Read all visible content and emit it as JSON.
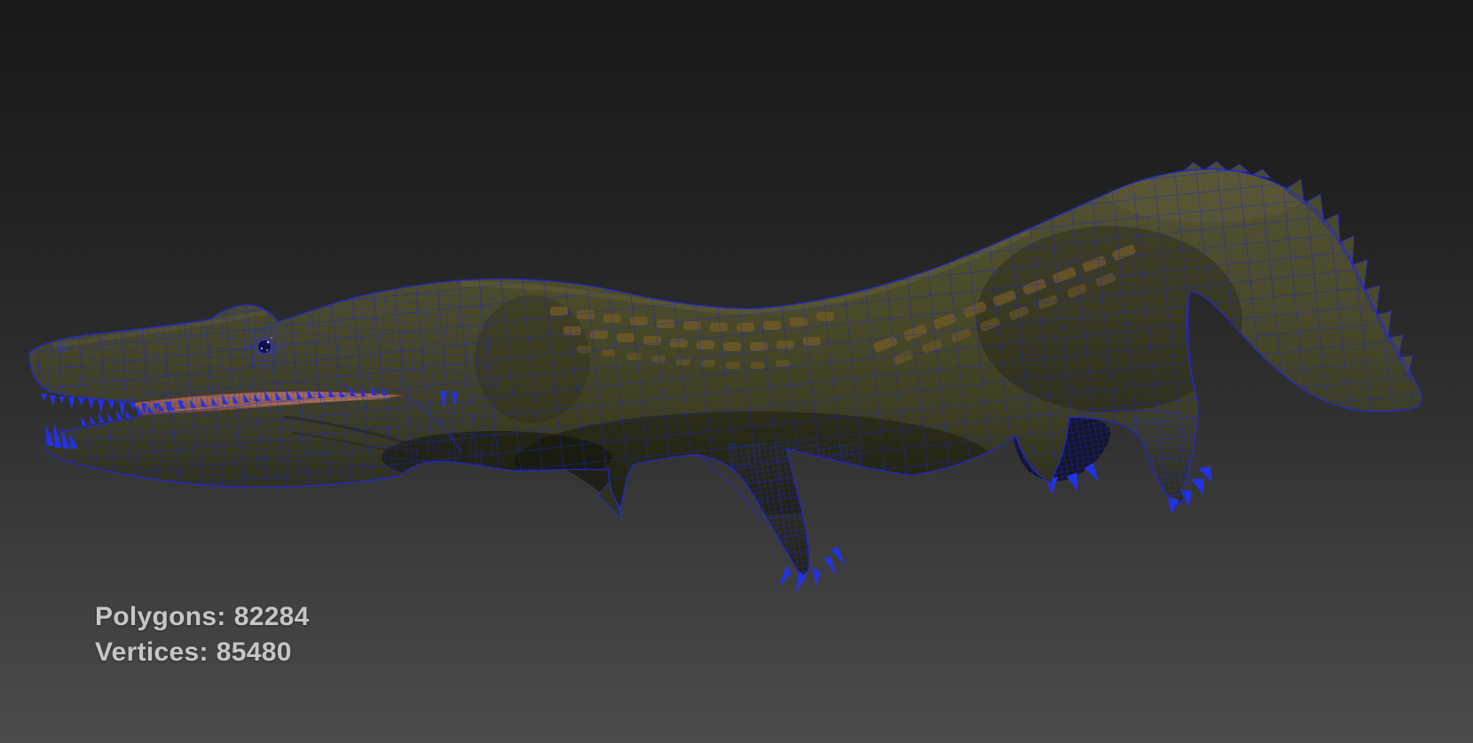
{
  "stats_overlay": {
    "polygons": {
      "label": "Polygons:",
      "value": "82284"
    },
    "vertices": {
      "label": "Vertices:",
      "value": "85480"
    }
  },
  "colors": {
    "background_top": "#181818",
    "background_bottom": "#4b4b4b",
    "wireframe_blue": "#2128d8",
    "body_olive": "#46462a",
    "body_highlight": "#5a5732",
    "body_shadow": "#23240f",
    "scute_brown": "#6f5a26",
    "mouth_interior_pink": "#996450",
    "stats_text": "#c6c6c6"
  }
}
